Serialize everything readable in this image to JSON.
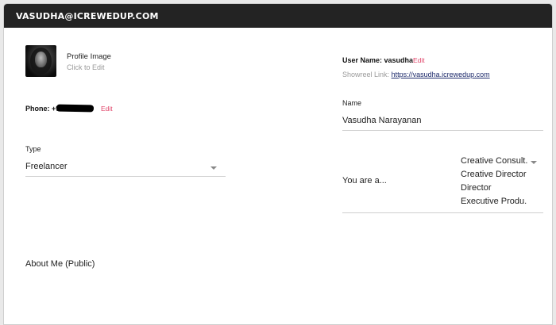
{
  "header": {
    "title": "VASUDHA@ICREWEDUP.COM"
  },
  "profile_image": {
    "label": "Profile Image",
    "hint": "Click to Edit"
  },
  "phone": {
    "label": "Phone: +91",
    "edit_label": "Edit"
  },
  "type": {
    "label": "Type",
    "value": "Freelancer"
  },
  "about": {
    "label": "About Me (Public)"
  },
  "username": {
    "label": "User Name: vasudha",
    "edit_label": "Edit"
  },
  "showreel": {
    "label": "Showreel Link:",
    "url": "https://vasudha.icrewedup.com"
  },
  "name": {
    "label": "Name",
    "value": "Vasudha Narayanan"
  },
  "you_are": {
    "label": "You are a...",
    "roles": [
      "Creative Consult...",
      "Creative Director",
      "Director",
      "Executive Produ..."
    ]
  },
  "colors": {
    "header_bg": "#232323",
    "edit_link": "#e0456a",
    "link": "#1d2a6b"
  }
}
